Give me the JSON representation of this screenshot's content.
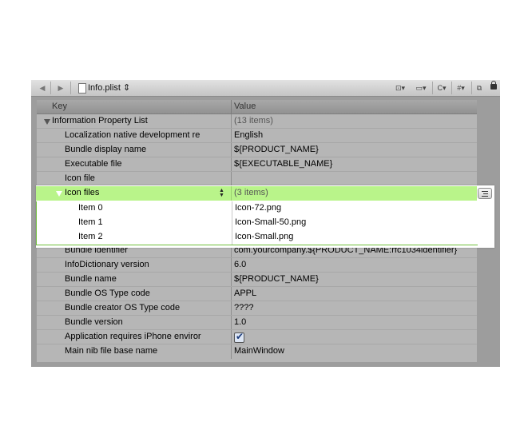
{
  "toolbar": {
    "filename": "Info.plist ⇕",
    "buttons": [
      {
        "icon": "back-arrow-icon",
        "glyph": "◀"
      },
      {
        "icon": "forward-arrow-icon",
        "glyph": "▶"
      }
    ],
    "right_controls": [
      {
        "name": "bookmark-icon",
        "glyph": "⊡▾"
      },
      {
        "name": "related-files-icon",
        "glyph": "▭▾"
      },
      {
        "name": "c-menu",
        "glyph": "C▾"
      },
      {
        "name": "hash-menu",
        "glyph": "#▾"
      },
      {
        "name": "split-icon",
        "glyph": "⧉"
      }
    ]
  },
  "table": {
    "columns": [
      "Key",
      "Value"
    ],
    "rows_top": [
      {
        "key": "Information Property List",
        "value": "(13 items)",
        "level": 0,
        "disclosure": "expanded",
        "value_muted": true
      },
      {
        "key": "Localization native development re",
        "value": "English",
        "level": 1
      },
      {
        "key": "Bundle display name",
        "value": "${PRODUCT_NAME}",
        "level": 1
      },
      {
        "key": "Executable file",
        "value": "${EXECUTABLE_NAME}",
        "level": 1
      },
      {
        "key": "Icon file",
        "value": "",
        "level": 1
      }
    ],
    "selected_row": {
      "key": "Icon files",
      "value": "(3 items)"
    },
    "children": [
      {
        "key": "Item 0",
        "value": "Icon-72.png"
      },
      {
        "key": "Item 1",
        "value": "Icon-Small-50.png"
      },
      {
        "key": "Item 2",
        "value": "Icon-Small.png"
      }
    ],
    "rows_bottom": [
      {
        "key": "Bundle identifier",
        "value": "com.yourcompany.${PRODUCT_NAME:rfc1034identifier}"
      },
      {
        "key": "InfoDictionary version",
        "value": "6.0"
      },
      {
        "key": "Bundle name",
        "value": "${PRODUCT_NAME}"
      },
      {
        "key": "Bundle OS Type code",
        "value": "APPL"
      },
      {
        "key": "Bundle creator OS Type code",
        "value": "????"
      },
      {
        "key": "Bundle version",
        "value": "1.0"
      },
      {
        "key": "Application requires iPhone enviror",
        "value": "",
        "checkbox": true
      },
      {
        "key": "Main nib file base name",
        "value": "MainWindow"
      }
    ]
  },
  "colors": {
    "selection_green": "#b9f48a",
    "table_bg": "#b6b6b6"
  }
}
